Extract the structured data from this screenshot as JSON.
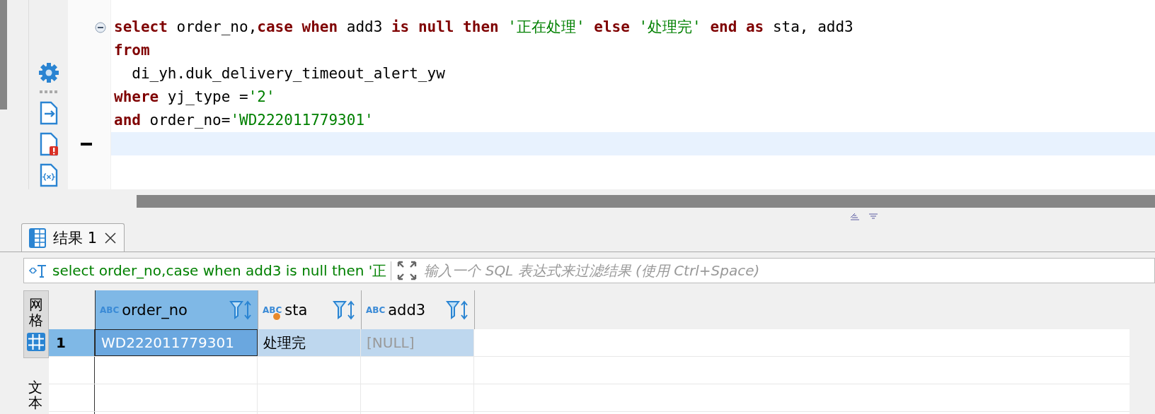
{
  "editor": {
    "lines": [
      {
        "collapsible": true,
        "current": false,
        "tokens": [
          {
            "kind": "keyword",
            "text": "select"
          },
          {
            "kind": "plain",
            "text": " order_no,"
          },
          {
            "kind": "keyword",
            "text": "case when"
          },
          {
            "kind": "plain",
            "text": " add3 "
          },
          {
            "kind": "keyword",
            "text": "is null then"
          },
          {
            "kind": "string",
            "text": " '正在处理'"
          },
          {
            "kind": "keyword",
            "text": " else"
          },
          {
            "kind": "string",
            "text": " '处理完'"
          },
          {
            "kind": "keyword",
            "text": " end as"
          },
          {
            "kind": "plain",
            "text": " sta, add3"
          }
        ]
      },
      {
        "current": false,
        "tokens": [
          {
            "kind": "keyword",
            "text": "from"
          }
        ]
      },
      {
        "current": false,
        "tokens": [
          {
            "kind": "plain",
            "text": "  di_yh.duk_delivery_timeout_alert_yw"
          }
        ]
      },
      {
        "current": false,
        "tokens": [
          {
            "kind": "keyword",
            "text": "where"
          },
          {
            "kind": "plain",
            "text": " yj_type ="
          },
          {
            "kind": "string",
            "text": "'2'"
          }
        ]
      },
      {
        "current": false,
        "tokens": [
          {
            "kind": "keyword",
            "text": "and"
          },
          {
            "kind": "plain",
            "text": " order_no="
          },
          {
            "kind": "string",
            "text": "'WD222011779301'"
          }
        ]
      },
      {
        "current": true
      }
    ]
  },
  "result_tabs": [
    {
      "label": "结果 1",
      "selected": true
    }
  ],
  "filter": {
    "query": "select order_no,case when add3 is null then '正",
    "placeholder": "输入一个 SQL 表达式来过滤结果 (使用 Ctrl+Space)"
  },
  "view_tabs": [
    {
      "label": "网格",
      "selected": true
    },
    {
      "label": "文本",
      "selected": false
    }
  ],
  "grid": {
    "columns": [
      {
        "type": "ABC",
        "name": "order_no",
        "selected": true,
        "flagged": false
      },
      {
        "type": "ABC",
        "name": "sta",
        "selected": false,
        "flagged": true
      },
      {
        "type": "ABC",
        "name": "add3",
        "selected": false,
        "flagged": false
      }
    ],
    "rows": [
      {
        "number": "1",
        "selected": true,
        "cells": [
          {
            "text": "WD222011779301",
            "null": false,
            "focused": true
          },
          {
            "text": "处理完",
            "null": false,
            "focused": false
          },
          {
            "text": "[NULL]",
            "null": true,
            "focused": false
          }
        ]
      }
    ]
  }
}
